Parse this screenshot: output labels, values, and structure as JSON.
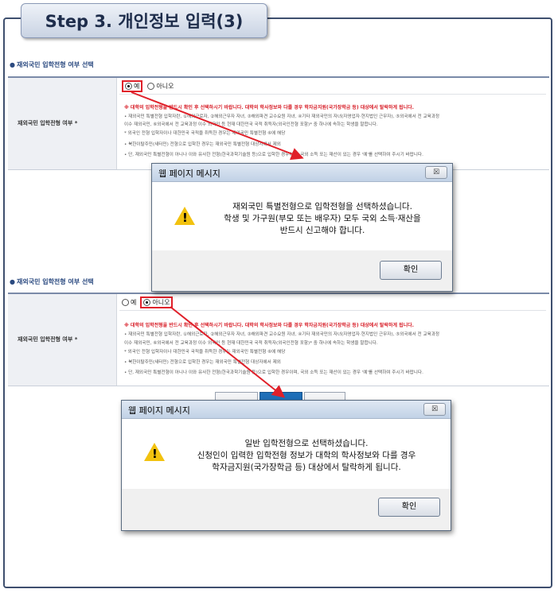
{
  "step_title": "Step 3. 개인정보 입력(3)",
  "section1": {
    "title": "재외국민 입학전형 여부 선택",
    "label": "재외국민 입학전형 여부 *",
    "option_yes": "예",
    "option_no": "아니오",
    "selected": "예",
    "warning": "※ 대학의 입학전형을 반드시 확인 후 선택하시기 바랍니다. 대학의 학사정보와 다를 경우 학자금지원(국가장학금 등) 대상에서 탈락하게 됩니다.",
    "notes": [
      "• 재외국민 특별전형 입학자란, ①해외근로자, ②해외근무자 자녀, ③해외파견 교수요원 자녀, ④기타 재외국민의 자녀(자영업자·현지법인 근무자), ⑤외국에서 전 교육과정",
      "  이수 재외국민, ⑥외국에서 전 교육과정 이수 외국인 등 현재 대한민국 국적 취득자(외국인전형 포함)* 중 하나에 속하는 학생을 말합니다.",
      "  * 외국인 전형 입학자이나 대한민국 국적을 취득한 경우는 재외국민 특별전형 ⑥에 해당",
      "• 북한이탈주민(새터민) 전형으로 입학한 경우는 재외국민 특별전형 대상자에서 제외",
      "• 단, 재외국민 특별전형이 아니나 이와 유사한 전형(한국과학기술원 등)으로 입학한 경우이며, 국외 소득 또는 재산이 있는 경우 '예'를 선택하여 주시기 바랍니다."
    ]
  },
  "dialog1": {
    "title": "웹 페이지 메시지",
    "close": "☒",
    "message": [
      "재외국민 특별전형으로 입학전형을 선택하셨습니다.",
      "학생 및 가구원(부모 또는 배우자) 모두 국외 소득·재산을",
      "반드시 신고해야 합니다."
    ],
    "ok": "확인"
  },
  "section2": {
    "title": "재외국민 입학전형 여부 선택",
    "label": "재외국민 입학전형 여부 *",
    "option_yes": "예",
    "option_no": "아니오",
    "selected": "아니오",
    "warning": "※ 대학의 입학전형을 반드시 확인 후 선택하시기 바랍니다. 대학의 학사정보와 다를 경우 학자금지원(국가장학금 등) 대상에서 탈락하게 됩니다.",
    "notes": [
      "• 재외국민 특별전형 입학자란, ①해외근로자, ②해외근무자 자녀, ③해외파견 교수요원 자녀, ④기타 재외국민의 자녀(자영업자·현지법인 근무자), ⑤외국에서 전 교육과정",
      "  이수 재외국민, ⑥외국에서 전 교육과정 이수 외국인 등 현재 대한민국 국적 취득자(외국인전형 포함)* 중 하나에 속하는 학생을 말합니다.",
      "  * 외국인 전형 입학자이나 대한민국 국적을 취득한 경우는 재외국민 특별전형 ⑥에 해당",
      "• 북한이탈주민(새터민) 전형으로 입학한 경우는 재외국민 특별전형 대상자에서 제외",
      "• 단, 재외국민 특별전형이 아니나 이와 유사한 전형(한국과학기술원 등)으로 입학한 경우이며, 국외 소득 또는 재산이 있는 경우 '예'를 선택하여 주시기 바랍니다."
    ]
  },
  "dialog2": {
    "title": "웹 페이지 메시지",
    "close": "☒",
    "message": [
      "일반 입학전형으로 선택하셨습니다.",
      "신청인이 입력한 입학전형 정보가 대학의 학사정보와 다를 경우",
      "학자금지원(국가장학금 등) 대상에서 탈락하게 됩니다."
    ],
    "ok": "확인"
  },
  "colors": {
    "frame": "#3e4f6e",
    "highlight": "#e0202a",
    "warning_text": "#d8202a",
    "section_title": "#2b4a80",
    "nav_button_blue": "#1f6fb8"
  }
}
